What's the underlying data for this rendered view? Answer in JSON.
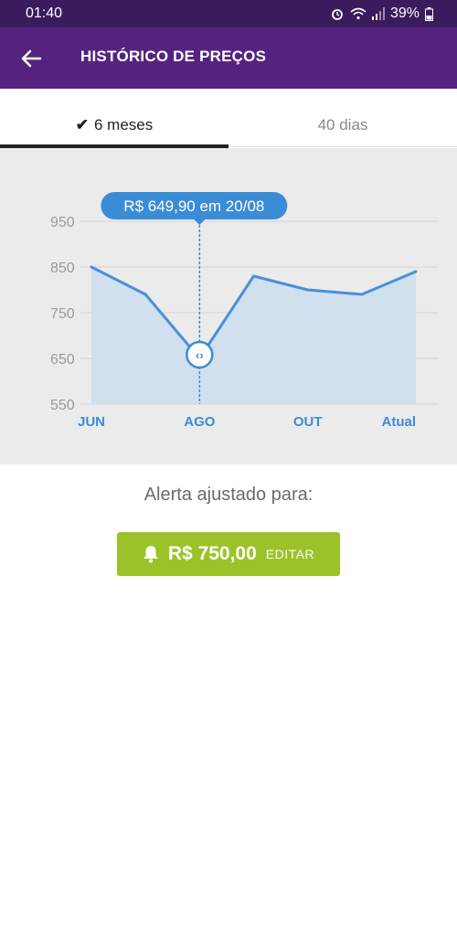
{
  "status_bar": {
    "time": "01:40",
    "battery": "39%"
  },
  "header": {
    "title": "HISTÓRICO DE PREÇOS"
  },
  "tabs": [
    {
      "label": "6 meses",
      "selected": true
    },
    {
      "label": "40 dias",
      "selected": false
    }
  ],
  "chart_data": {
    "type": "area",
    "x_labels": [
      "JUN",
      "AGO",
      "OUT",
      "Atual"
    ],
    "y_ticks": [
      950,
      850,
      750,
      650,
      550
    ],
    "ylim": [
      550,
      950
    ],
    "values": [
      850,
      790,
      650,
      830,
      800,
      790,
      840
    ],
    "highlight_index": 2,
    "tooltip": "R$ 649,90 em 20/08",
    "grid": true,
    "colors": {
      "line": "#4a90d9",
      "fill": "#cddff0",
      "tooltip": "#3b8cd6",
      "background": "#ebebeb"
    }
  },
  "alert": {
    "label": "Alerta ajustado para:",
    "price": "R$ 750,00",
    "edit_label": "EDITAR",
    "color": "#9cc22a"
  }
}
